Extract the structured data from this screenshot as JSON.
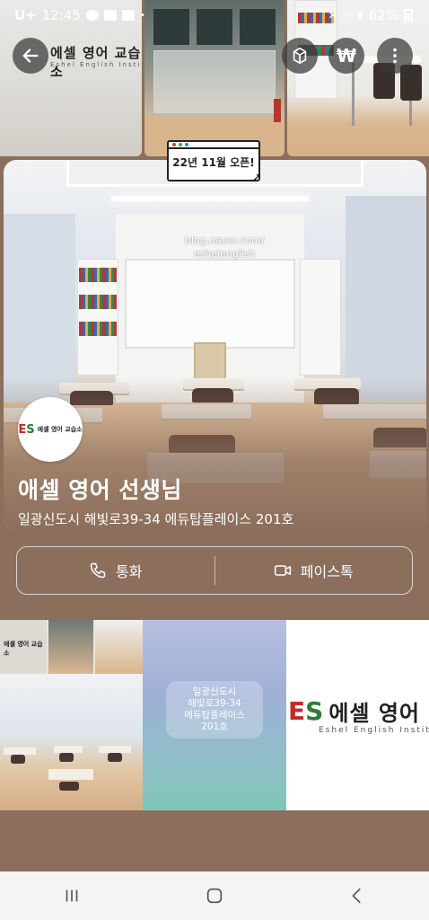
{
  "status_bar": {
    "carrier": "U+",
    "time": "12:45",
    "battery": "62%"
  },
  "top_buttons": {
    "back_icon": "arrow-left-icon",
    "cube_icon": "cube-icon",
    "won_label": "₩",
    "more_icon": "more-vertical-icon"
  },
  "badge": {
    "text": "22년 11월 오픈!"
  },
  "hero": {
    "watermark_line1": "blog.naver.com/",
    "watermark_line2": "eshelenglish"
  },
  "profile": {
    "avatar_logo": "ES",
    "avatar_name": "에셀 영어 교습소",
    "title": "애셀 영어 선생님",
    "address": "일광신도시 해빛로39-34 에듀탑플레이스 201호"
  },
  "actions": {
    "call_label": "통화",
    "facetalk_label": "페이스톡"
  },
  "thumbnails": {
    "address_card_line1": "일광신도시",
    "address_card_line2": "해빛로39-34",
    "address_card_line3": "에듀탑플레이스",
    "address_card_line4": "201호",
    "logo_name": "에셀 영어 교습",
    "logo_en": "Eshel English Instit",
    "wall_logo": "에셀 영어 교습소",
    "wall_logo_en": "Eshel English Institute"
  },
  "colors": {
    "background": "#8b6e5c",
    "brand_green": "#2e7d32",
    "brand_red": "#c62828"
  }
}
